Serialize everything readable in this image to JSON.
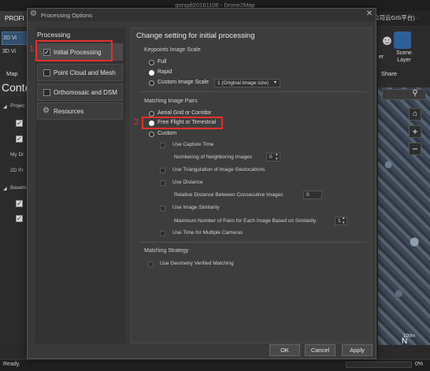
{
  "app": {
    "title": "gongdi20161106 - Drone2Map",
    "profile_tab": "PROFI",
    "company_text": "公司云GIS平台) ·",
    "btn_2d": "2D Vi",
    "btn_3d": "3D Vi",
    "map_label": "Map",
    "contents_title": "Conte",
    "share_label": "Share",
    "scene_layer_line1": "Scene",
    "scene_layer_line2": "Layer",
    "partial_label": "er",
    "side_items": [
      "Projec",
      "My Dr",
      "2D Pr",
      "Basem"
    ],
    "status_ready": "Ready.",
    "status_progress": "0%",
    "scale_text": "100m",
    "compass_label": "N"
  },
  "dialog": {
    "title": "Processing Options",
    "nav_title": "Processing",
    "nav_items": [
      {
        "label": "Initial Processing",
        "checked": true
      },
      {
        "label": "Point Cloud and Mesh",
        "checked": false
      },
      {
        "label": "Orthomosaic and DSM",
        "checked": false
      },
      {
        "label": "Resources",
        "icon": "gear-icon"
      }
    ],
    "settings_title": "Change setting for initial processing",
    "keypoints": {
      "label": "Keypoints Image Scale",
      "options": [
        "Full",
        "Rapid",
        "Custom Image Scale"
      ],
      "selected": "Rapid",
      "custom_value": "1 (Original image size)"
    },
    "matching_pairs": {
      "label": "Matching Image Pairs",
      "options": [
        "Aerial Grid or Corridor",
        "Free Flight or Terrestrial",
        "Custom"
      ],
      "selected": "Free Flight or Terrestrial",
      "custom": {
        "use_capture_time": "Use Capture Time",
        "num_neighboring": "Numbering of Neighboring Images",
        "num_neighboring_value": "0",
        "use_triangulation": "Use Triangulation of Image Geolocations",
        "use_distance": "Use Distance",
        "relative_distance": "Relative Distance Between Consecutive Images",
        "relative_distance_value": "0",
        "use_similarity": "Use Image Similarity",
        "max_pairs": "Maximum Number of Pairs for Each Image Based on Similarity",
        "max_pairs_value": "1",
        "use_time_multi": "Use Time for Multiple Cameras"
      }
    },
    "matching_strategy": {
      "label": "Matching Strategy",
      "use_geometry": "Use Geometry Verified Matching"
    },
    "buttons": {
      "ok": "OK",
      "cancel": "Cancel",
      "apply": "Apply"
    },
    "annotations": {
      "marker1": "1",
      "marker2": "2",
      "color": "#e4312b"
    }
  }
}
